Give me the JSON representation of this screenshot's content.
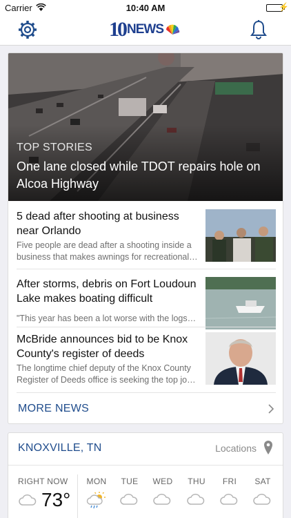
{
  "status_bar": {
    "carrier": "Carrier",
    "time": "10:40 AM"
  },
  "nav": {
    "logo_number": "10",
    "logo_word": "NEWS",
    "left_icon": "gear-icon",
    "right_icon": "bell-icon"
  },
  "top_story": {
    "kicker": "TOP STORIES",
    "headline": "One lane closed while TDOT repairs hole on Alcoa Highway"
  },
  "stories": [
    {
      "title": "5 dead after shooting at business near Orlando",
      "snippet": "Five people are dead after a shooting inside a business that makes awnings for recreational…"
    },
    {
      "title": "After storms, debris on Fort Loudoun Lake makes boating difficult",
      "snippet": "\"This year has been a lot worse with the logs…"
    },
    {
      "title": "McBride announces bid to be Knox County's register of deeds",
      "snippet": "The longtime chief deputy of the Knox County Register of Deeds office is seeking the top jo…"
    }
  ],
  "more_news": {
    "label": "MORE NEWS"
  },
  "weather": {
    "city": "KNOXVILLE, TN",
    "locations_label": "Locations",
    "right_now_label": "RIGHT NOW",
    "temperature": "73°",
    "days": [
      "MON",
      "TUE",
      "WED",
      "THU",
      "FRI",
      "SAT"
    ],
    "day_icons": [
      "sun-rain-icon",
      "cloud-icon",
      "cloud-icon",
      "cloud-icon",
      "cloud-icon",
      "cloud-icon"
    ]
  },
  "colors": {
    "brand_blue": "#1f4c8c",
    "battery_green": "#2ac84b"
  }
}
